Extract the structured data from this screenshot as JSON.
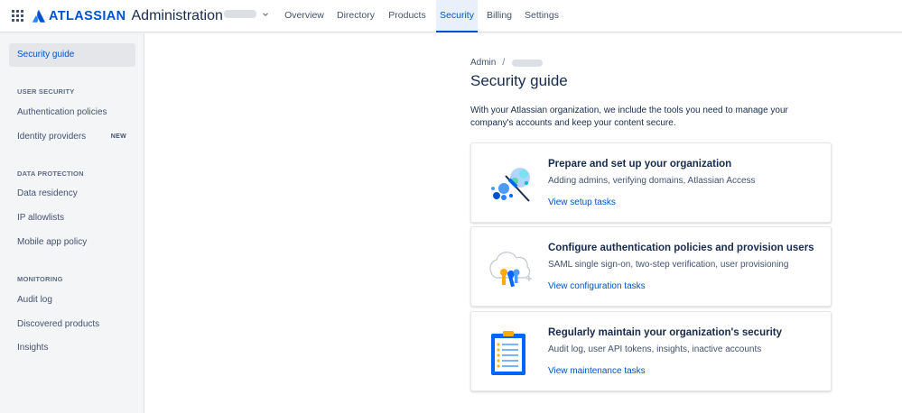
{
  "header": {
    "brand": "ATLASSIAN",
    "app_title": "Administration",
    "nav": [
      {
        "label": "Overview"
      },
      {
        "label": "Directory"
      },
      {
        "label": "Products"
      },
      {
        "label": "Security"
      },
      {
        "label": "Billing"
      },
      {
        "label": "Settings"
      }
    ],
    "active_nav": "Security"
  },
  "sidebar": {
    "top_item": "Security guide",
    "sections": [
      {
        "heading": "USER SECURITY",
        "items": [
          {
            "label": "Authentication policies"
          },
          {
            "label": "Identity providers",
            "badge": "NEW"
          }
        ]
      },
      {
        "heading": "DATA PROTECTION",
        "items": [
          {
            "label": "Data residency"
          },
          {
            "label": "IP allowlists"
          },
          {
            "label": "Mobile app policy"
          }
        ]
      },
      {
        "heading": "MONITORING",
        "items": [
          {
            "label": "Audit log"
          },
          {
            "label": "Discovered products"
          },
          {
            "label": "Insights"
          }
        ]
      }
    ]
  },
  "main": {
    "breadcrumb_root": "Admin",
    "breadcrumb_sep": "/",
    "title": "Security guide",
    "intro": "With your Atlassian organization, we include the tools you need to manage your company's accounts and keep your content secure.",
    "cards": [
      {
        "title": "Prepare and set up your organization",
        "description": "Adding admins, verifying domains, Atlassian Access",
        "link": "View setup tasks",
        "illustration": "telescope-planets-icon"
      },
      {
        "title": "Configure authentication policies and provision users",
        "description": "SAML single sign-on, two-step verification, user provisioning",
        "link": "View configuration tasks",
        "illustration": "cloud-keys-icon"
      },
      {
        "title": "Regularly maintain your organization's security",
        "description": "Audit log, user API tokens, insights, inactive accounts",
        "link": "View maintenance tasks",
        "illustration": "clipboard-checklist-icon"
      }
    ]
  },
  "colors": {
    "brand_blue": "#0052cc",
    "text": "#172b4d",
    "subtle_text": "#42526e",
    "sidebar_bg": "#f4f5f7"
  }
}
